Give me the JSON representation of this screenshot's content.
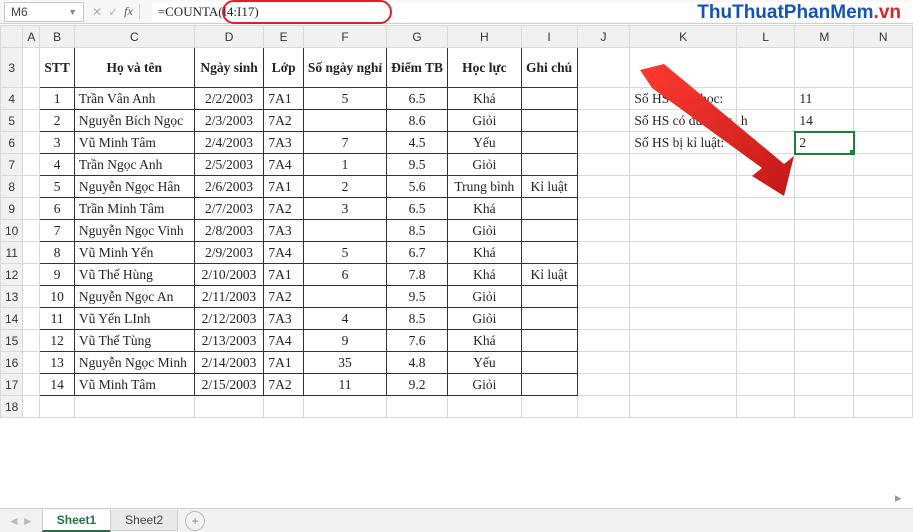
{
  "active_cell": "M6",
  "formula": "=COUNTA(I4:I17)",
  "watermark_blue": "ThuThuatPhanMem",
  "watermark_red": ".vn",
  "col_headers": [
    "A",
    "B",
    "C",
    "D",
    "E",
    "F",
    "G",
    "H",
    "I",
    "J",
    "K",
    "L",
    "M",
    "N"
  ],
  "row_headers": [
    "3",
    "4",
    "5",
    "6",
    "7",
    "8",
    "9",
    "10",
    "11",
    "12",
    "13",
    "14",
    "15",
    "16",
    "17",
    "18"
  ],
  "table": {
    "headers": {
      "stt": "STT",
      "name": "Họ và tên",
      "dob": "Ngày sinh",
      "class": "Lớp",
      "days": "Số ngày nghỉ",
      "avg": "Điểm TB",
      "rank": "Học lực",
      "note": "Ghi chú"
    },
    "rows": [
      {
        "stt": "1",
        "name": "Trần Vân Anh",
        "dob": "2/2/2003",
        "class": "7A1",
        "days": "5",
        "avg": "6.5",
        "rank": "Khá",
        "note": ""
      },
      {
        "stt": "2",
        "name": "Nguyễn Bích Ngọc",
        "dob": "2/3/2003",
        "class": "7A2",
        "days": "",
        "avg": "8.6",
        "rank": "Giỏi",
        "note": ""
      },
      {
        "stt": "3",
        "name": "Vũ Minh Tâm",
        "dob": "2/4/2003",
        "class": "7A3",
        "days": "7",
        "avg": "4.5",
        "rank": "Yếu",
        "note": ""
      },
      {
        "stt": "4",
        "name": "Trần Ngọc Anh",
        "dob": "2/5/2003",
        "class": "7A4",
        "days": "1",
        "avg": "9.5",
        "rank": "Giỏi",
        "note": ""
      },
      {
        "stt": "5",
        "name": "Nguyễn Ngọc Hân",
        "dob": "2/6/2003",
        "class": "7A1",
        "days": "2",
        "avg": "5.6",
        "rank": "Trung bình",
        "note": "Kỉ luật"
      },
      {
        "stt": "6",
        "name": "Trần Minh Tâm",
        "dob": "2/7/2003",
        "class": "7A2",
        "days": "3",
        "avg": "6.5",
        "rank": "Khá",
        "note": ""
      },
      {
        "stt": "7",
        "name": "Nguyễn Ngọc Vinh",
        "dob": "2/8/2003",
        "class": "7A3",
        "days": "",
        "avg": "8.5",
        "rank": "Giỏi",
        "note": ""
      },
      {
        "stt": "8",
        "name": "Vũ Minh Yến",
        "dob": "2/9/2003",
        "class": "7A4",
        "days": "5",
        "avg": "6.7",
        "rank": "Khá",
        "note": ""
      },
      {
        "stt": "9",
        "name": "Vũ Thế Hùng",
        "dob": "2/10/2003",
        "class": "7A1",
        "days": "6",
        "avg": "7.8",
        "rank": "Khá",
        "note": "Kỉ luật"
      },
      {
        "stt": "10",
        "name": "Nguyễn Ngọc An",
        "dob": "2/11/2003",
        "class": "7A2",
        "days": "",
        "avg": "9.5",
        "rank": "Giỏi",
        "note": ""
      },
      {
        "stt": "11",
        "name": "Vũ  Yến LInh",
        "dob": "2/12/2003",
        "class": "7A3",
        "days": "4",
        "avg": "8.5",
        "rank": "Giỏi",
        "note": ""
      },
      {
        "stt": "12",
        "name": "Vũ Thế Tùng",
        "dob": "2/13/2003",
        "class": "7A4",
        "days": "9",
        "avg": "7.6",
        "rank": "Khá",
        "note": ""
      },
      {
        "stt": "13",
        "name": "Nguyễn Ngọc Minh",
        "dob": "2/14/2003",
        "class": "7A1",
        "days": "35",
        "avg": "4.8",
        "rank": "Yếu",
        "note": ""
      },
      {
        "stt": "14",
        "name": "Vũ Minh Tâm",
        "dob": "2/15/2003",
        "class": "7A2",
        "days": "11",
        "avg": "9.2",
        "rank": "Giỏi",
        "note": ""
      }
    ]
  },
  "summary": {
    "row4_label": "Số HS nghỉ học:",
    "row4_val": "11",
    "row5_label": "Số HS có đủ ngày",
    "row5_extra": "h",
    "row5_val": "14",
    "row6_label": "Số HS bị kỉ luật:",
    "row6_val": "2"
  },
  "tabs": {
    "sheet1": "Sheet1",
    "sheet2": "Sheet2"
  }
}
